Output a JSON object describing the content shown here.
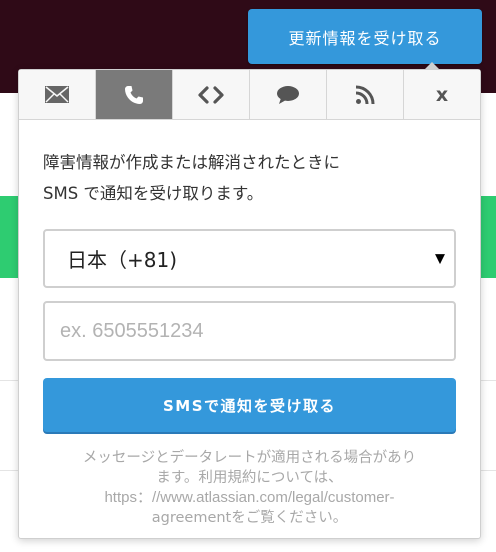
{
  "header": {
    "subscribe_label": "更新情報を受け取る"
  },
  "colors": {
    "header_bg": "#2f0a17",
    "accent": "#3498db",
    "status_green": "#2ecc71",
    "active_tab": "#7a7a7a"
  },
  "tabs": [
    {
      "icon": "envelope-icon",
      "active": false
    },
    {
      "icon": "phone-icon",
      "active": true
    },
    {
      "icon": "code-icon",
      "active": false
    },
    {
      "icon": "chat-bubble-icon",
      "active": false
    },
    {
      "icon": "rss-icon",
      "active": false
    },
    {
      "label": "x",
      "icon": "close-icon",
      "active": false
    }
  ],
  "sms": {
    "description_line1": "障害情報が作成または解消されたときに",
    "description_line2": "SMS で通知を受け取ります。",
    "country_selected": "日本（+81)",
    "phone_placeholder": "ex. 6505551234",
    "button_label": "SMSで通知を受け取る",
    "disclaimer_line1": "メッセージとデータレートが適用される場合があり",
    "disclaimer_line2": "ます。利用規約については、",
    "disclaimer_url": "https：//www.atlassian.com/legal/customer-",
    "disclaimer_line4": "agreementをご覧ください。"
  }
}
